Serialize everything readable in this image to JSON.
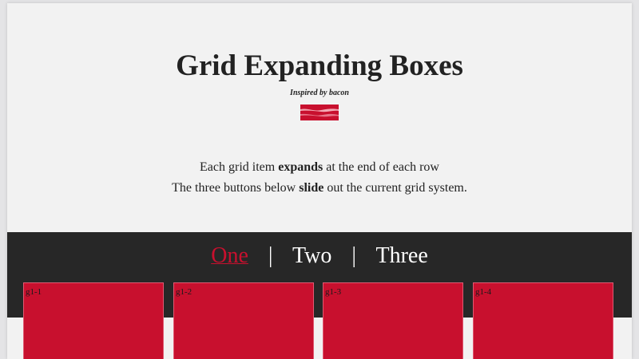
{
  "header": {
    "title": "Grid Expanding Boxes",
    "subtitle": "Inspired by bacon",
    "logo_icon": "bacon-icon",
    "desc_line1": {
      "before": "Each grid item ",
      "bold": "expands",
      "after": " at the end of each row"
    },
    "desc_line2": {
      "before": "The three buttons below ",
      "bold": "slide",
      "after": " out the current grid system."
    }
  },
  "nav": {
    "tabs": [
      "One",
      "Two",
      "Three"
    ],
    "separator": "|",
    "active": "One"
  },
  "grid": {
    "items": [
      "g1-1",
      "g1-2",
      "g1-3",
      "g1-4"
    ]
  },
  "colors": {
    "accent": "#c8102e",
    "band": "#272727",
    "page": "#f2f2f2"
  }
}
